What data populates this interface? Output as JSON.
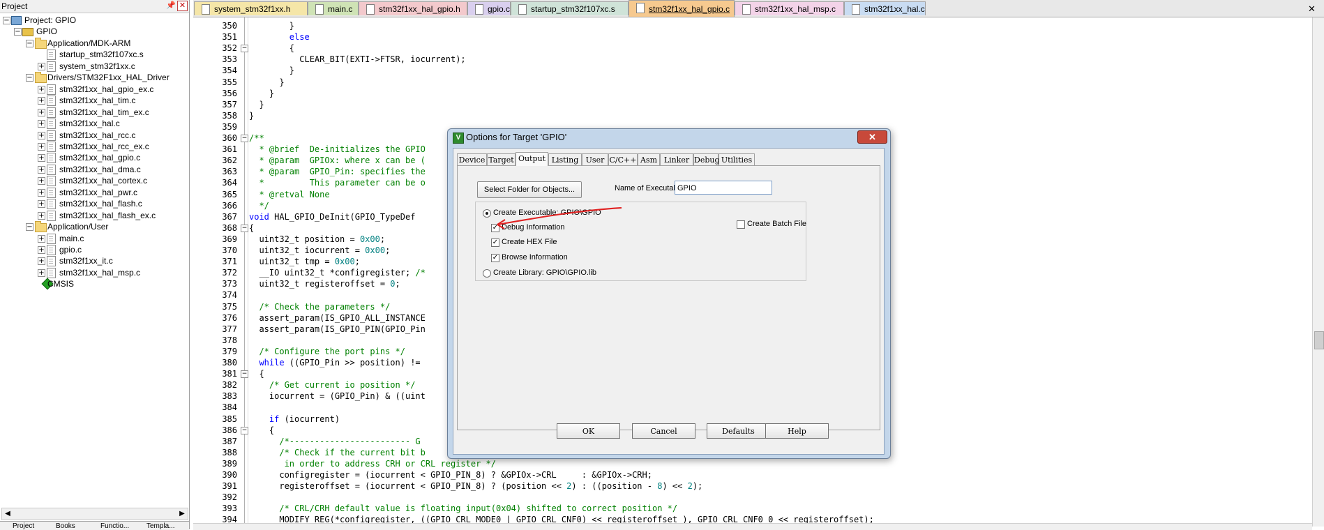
{
  "project_panel": {
    "title": "Project",
    "tree": [
      {
        "label": "Project: GPIO",
        "level": 0,
        "kind": "root",
        "toggle": "−"
      },
      {
        "label": "GPIO",
        "level": 1,
        "kind": "target",
        "toggle": "−"
      },
      {
        "label": "Application/MDK-ARM",
        "level": 2,
        "kind": "folder",
        "toggle": "−"
      },
      {
        "label": "startup_stm32f107xc.s",
        "level": 3,
        "kind": "file",
        "toggle": ""
      },
      {
        "label": "system_stm32f1xx.c",
        "level": 3,
        "kind": "file",
        "toggle": "+"
      },
      {
        "label": "Drivers/STM32F1xx_HAL_Driver",
        "level": 2,
        "kind": "folder",
        "toggle": "−"
      },
      {
        "label": "stm32f1xx_hal_gpio_ex.c",
        "level": 3,
        "kind": "file",
        "toggle": "+"
      },
      {
        "label": "stm32f1xx_hal_tim.c",
        "level": 3,
        "kind": "file",
        "toggle": "+"
      },
      {
        "label": "stm32f1xx_hal_tim_ex.c",
        "level": 3,
        "kind": "file",
        "toggle": "+"
      },
      {
        "label": "stm32f1xx_hal.c",
        "level": 3,
        "kind": "file",
        "toggle": "+"
      },
      {
        "label": "stm32f1xx_hal_rcc.c",
        "level": 3,
        "kind": "file",
        "toggle": "+"
      },
      {
        "label": "stm32f1xx_hal_rcc_ex.c",
        "level": 3,
        "kind": "file",
        "toggle": "+"
      },
      {
        "label": "stm32f1xx_hal_gpio.c",
        "level": 3,
        "kind": "file",
        "toggle": "+"
      },
      {
        "label": "stm32f1xx_hal_dma.c",
        "level": 3,
        "kind": "file",
        "toggle": "+"
      },
      {
        "label": "stm32f1xx_hal_cortex.c",
        "level": 3,
        "kind": "file",
        "toggle": "+"
      },
      {
        "label": "stm32f1xx_hal_pwr.c",
        "level": 3,
        "kind": "file",
        "toggle": "+"
      },
      {
        "label": "stm32f1xx_hal_flash.c",
        "level": 3,
        "kind": "file",
        "toggle": "+"
      },
      {
        "label": "stm32f1xx_hal_flash_ex.c",
        "level": 3,
        "kind": "file",
        "toggle": "+"
      },
      {
        "label": "Application/User",
        "level": 2,
        "kind": "folder",
        "toggle": "−"
      },
      {
        "label": "main.c",
        "level": 3,
        "kind": "file",
        "toggle": "+"
      },
      {
        "label": "gpio.c",
        "level": 3,
        "kind": "file",
        "toggle": "+"
      },
      {
        "label": "stm32f1xx_it.c",
        "level": 3,
        "kind": "file",
        "toggle": "+"
      },
      {
        "label": "stm32f1xx_hal_msp.c",
        "level": 3,
        "kind": "file",
        "toggle": "+"
      },
      {
        "label": "CMSIS",
        "level": 2,
        "kind": "cmsis",
        "toggle": ""
      }
    ],
    "bottom_tabs": [
      "Project",
      "Books",
      "Functio...",
      "Templa..."
    ]
  },
  "editor": {
    "tabs": [
      {
        "label": "system_stm32f1xx.h",
        "color": "#f5e6a8",
        "active": false
      },
      {
        "label": "main.c",
        "color": "#cfe3b5",
        "active": false
      },
      {
        "label": "stm32f1xx_hal_gpio.h",
        "color": "#f3c9cc",
        "active": false
      },
      {
        "label": "gpio.c",
        "color": "#d9cfee",
        "active": false
      },
      {
        "label": "startup_stm32f107xc.s",
        "color": "#cfe3d8",
        "active": false
      },
      {
        "label": "stm32f1xx_hal_gpio.c",
        "color": "#f6c98f",
        "active": true
      },
      {
        "label": "stm32f1xx_hal_msp.c",
        "color": "#f3d3e8",
        "active": false
      },
      {
        "label": "stm32f1xx_hal.c",
        "color": "#c9dcf2",
        "active": false
      }
    ],
    "lines": [
      {
        "n": "350",
        "fold": "",
        "segs": [
          {
            "t": "        }",
            "c": "#000000"
          }
        ]
      },
      {
        "n": "351",
        "fold": "",
        "segs": [
          {
            "t": "        ",
            "c": "#000000"
          },
          {
            "t": "else",
            "c": "#0000ff"
          }
        ]
      },
      {
        "n": "352",
        "fold": "−",
        "segs": [
          {
            "t": "        {",
            "c": "#000000"
          }
        ]
      },
      {
        "n": "353",
        "fold": "",
        "segs": [
          {
            "t": "          CLEAR_BIT(EXTI->FTSR, iocurrent);",
            "c": "#000000"
          }
        ]
      },
      {
        "n": "354",
        "fold": "",
        "segs": [
          {
            "t": "        }",
            "c": "#000000"
          }
        ]
      },
      {
        "n": "355",
        "fold": "",
        "segs": [
          {
            "t": "      }",
            "c": "#000000"
          }
        ]
      },
      {
        "n": "356",
        "fold": "",
        "segs": [
          {
            "t": "    }",
            "c": "#000000"
          }
        ]
      },
      {
        "n": "357",
        "fold": "",
        "segs": [
          {
            "t": "  }",
            "c": "#000000"
          }
        ]
      },
      {
        "n": "358",
        "fold": "",
        "segs": [
          {
            "t": "}",
            "c": "#000000"
          }
        ]
      },
      {
        "n": "359",
        "fold": "",
        "segs": []
      },
      {
        "n": "360",
        "fold": "−",
        "segs": [
          {
            "t": "/**",
            "c": "#008000"
          }
        ]
      },
      {
        "n": "361",
        "fold": "",
        "segs": [
          {
            "t": "  * @brief  De-initializes the GPIO",
            "c": "#008000"
          }
        ]
      },
      {
        "n": "362",
        "fold": "",
        "segs": [
          {
            "t": "  * @param  GPIOx: where x can be (",
            "c": "#008000"
          }
        ]
      },
      {
        "n": "363",
        "fold": "",
        "segs": [
          {
            "t": "  * @param  GPIO_Pin: specifies the",
            "c": "#008000"
          }
        ]
      },
      {
        "n": "364",
        "fold": "",
        "segs": [
          {
            "t": "  *         This parameter can be o",
            "c": "#008000"
          }
        ]
      },
      {
        "n": "365",
        "fold": "",
        "segs": [
          {
            "t": "  * @retval None",
            "c": "#008000"
          }
        ]
      },
      {
        "n": "366",
        "fold": "",
        "segs": [
          {
            "t": "  */",
            "c": "#008000"
          }
        ]
      },
      {
        "n": "367",
        "fold": "",
        "segs": [
          {
            "t": "void",
            "c": "#0000ff"
          },
          {
            "t": " HAL_GPIO_DeInit(GPIO_TypeDef",
            "c": "#000000"
          }
        ]
      },
      {
        "n": "368",
        "fold": "−",
        "segs": [
          {
            "t": "{",
            "c": "#000000"
          }
        ]
      },
      {
        "n": "369",
        "fold": "",
        "segs": [
          {
            "t": "  uint32_t position = ",
            "c": "#000000"
          },
          {
            "t": "0x00",
            "c": "#008080"
          },
          {
            "t": ";",
            "c": "#000000"
          }
        ]
      },
      {
        "n": "370",
        "fold": "",
        "segs": [
          {
            "t": "  uint32_t iocurrent = ",
            "c": "#000000"
          },
          {
            "t": "0x00",
            "c": "#008080"
          },
          {
            "t": ";",
            "c": "#000000"
          }
        ]
      },
      {
        "n": "371",
        "fold": "",
        "segs": [
          {
            "t": "  uint32_t tmp = ",
            "c": "#000000"
          },
          {
            "t": "0x00",
            "c": "#008080"
          },
          {
            "t": ";",
            "c": "#000000"
          }
        ]
      },
      {
        "n": "372",
        "fold": "",
        "segs": [
          {
            "t": "  __IO uint32_t *configregister; ",
            "c": "#000000"
          },
          {
            "t": "/*",
            "c": "#008000"
          }
        ]
      },
      {
        "n": "373",
        "fold": "",
        "segs": [
          {
            "t": "  uint32_t registeroffset = ",
            "c": "#000000"
          },
          {
            "t": "0",
            "c": "#008080"
          },
          {
            "t": ";",
            "c": "#000000"
          }
        ]
      },
      {
        "n": "374",
        "fold": "",
        "segs": []
      },
      {
        "n": "375",
        "fold": "",
        "segs": [
          {
            "t": "  /* Check the parameters */",
            "c": "#008000"
          }
        ]
      },
      {
        "n": "376",
        "fold": "",
        "segs": [
          {
            "t": "  assert_param(IS_GPIO_ALL_INSTANCE",
            "c": "#000000"
          }
        ]
      },
      {
        "n": "377",
        "fold": "",
        "segs": [
          {
            "t": "  assert_param(IS_GPIO_PIN(GPIO_Pin",
            "c": "#000000"
          }
        ]
      },
      {
        "n": "378",
        "fold": "",
        "segs": []
      },
      {
        "n": "379",
        "fold": "",
        "segs": [
          {
            "t": "  /* Configure the port pins */",
            "c": "#008000"
          }
        ]
      },
      {
        "n": "380",
        "fold": "",
        "segs": [
          {
            "t": "  ",
            "c": "#000000"
          },
          {
            "t": "while",
            "c": "#0000ff"
          },
          {
            "t": " ((GPIO_Pin >> position) !=",
            "c": "#000000"
          }
        ]
      },
      {
        "n": "381",
        "fold": "−",
        "segs": [
          {
            "t": "  {",
            "c": "#000000"
          }
        ]
      },
      {
        "n": "382",
        "fold": "",
        "segs": [
          {
            "t": "    /* Get current io position */",
            "c": "#008000"
          }
        ]
      },
      {
        "n": "383",
        "fold": "",
        "segs": [
          {
            "t": "    iocurrent = (GPIO_Pin) & ((uint",
            "c": "#000000"
          }
        ]
      },
      {
        "n": "384",
        "fold": "",
        "segs": []
      },
      {
        "n": "385",
        "fold": "",
        "segs": [
          {
            "t": "    ",
            "c": "#000000"
          },
          {
            "t": "if",
            "c": "#0000ff"
          },
          {
            "t": " (iocurrent)",
            "c": "#000000"
          }
        ]
      },
      {
        "n": "386",
        "fold": "−",
        "segs": [
          {
            "t": "    {",
            "c": "#000000"
          }
        ]
      },
      {
        "n": "387",
        "fold": "",
        "segs": [
          {
            "t": "      /*------------------------ G",
            "c": "#008000"
          }
        ]
      },
      {
        "n": "388",
        "fold": "",
        "segs": [
          {
            "t": "      /* Check if the current bit b",
            "c": "#008000"
          }
        ]
      },
      {
        "n": "389",
        "fold": "",
        "segs": [
          {
            "t": "       in order to address CRH or CRL register */",
            "c": "#008000"
          }
        ]
      },
      {
        "n": "390",
        "fold": "",
        "segs": [
          {
            "t": "      configregister = (iocurrent < GPIO_PIN_8) ? &GPIOx->CRL     : &GPIOx->CRH;",
            "c": "#000000"
          }
        ]
      },
      {
        "n": "391",
        "fold": "",
        "segs": [
          {
            "t": "      registeroffset = (iocurrent < GPIO_PIN_8) ? (position << ",
            "c": "#000000"
          },
          {
            "t": "2",
            "c": "#008080"
          },
          {
            "t": ") : ((position - ",
            "c": "#000000"
          },
          {
            "t": "8",
            "c": "#008080"
          },
          {
            "t": ") << ",
            "c": "#000000"
          },
          {
            "t": "2",
            "c": "#008080"
          },
          {
            "t": ");",
            "c": "#000000"
          }
        ]
      },
      {
        "n": "392",
        "fold": "",
        "segs": []
      },
      {
        "n": "393",
        "fold": "",
        "segs": [
          {
            "t": "      /* CRL/CRH default value is floating input(0x04) shifted to correct position */",
            "c": "#008000"
          }
        ]
      },
      {
        "n": "394",
        "fold": "",
        "segs": [
          {
            "t": "      MODIFY_REG(*configregister, ((GPIO_CRL_MODE0 | GPIO_CRL_CNF0) << registeroffset ), GPIO_CRL_CNF0_0 << registeroffset);",
            "c": "#000000"
          }
        ]
      }
    ]
  },
  "dialog": {
    "title": "Options for Target 'GPIO'",
    "close_glyph": "✕",
    "tabs": [
      "Device",
      "Target",
      "Output",
      "Listing",
      "User",
      "C/C++",
      "Asm",
      "Linker",
      "Debug",
      "Utilities"
    ],
    "active_tab": "Output",
    "select_folder_label": "Select Folder for Objects...",
    "exe_name_label": "Name of Executable:",
    "exe_name_value": "GPIO",
    "create_executable_label": "Create Executable:  GPIO\\GPIO",
    "debug_info_label": "Debug Information",
    "debug_info_checked": true,
    "create_hex_label": "Create HEX File",
    "create_hex_checked": true,
    "browse_info_label": "Browse Information",
    "browse_info_checked": true,
    "create_batch_label": "Create Batch File",
    "create_batch_checked": false,
    "create_library_label": "Create Library:  GPIO\\GPIO.lib",
    "buttons": {
      "ok": "OK",
      "cancel": "Cancel",
      "defaults": "Defaults",
      "help": "Help"
    },
    "annotation_color": "#e02020"
  }
}
